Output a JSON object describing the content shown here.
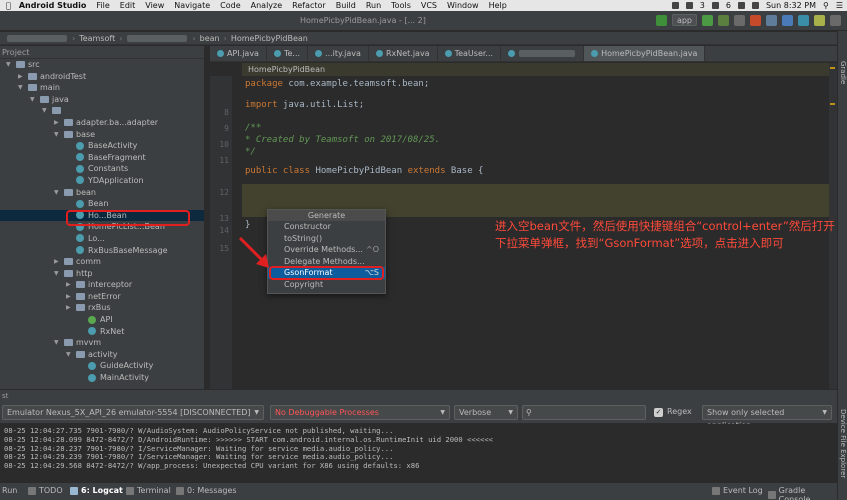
{
  "menubar": {
    "app_name": "Android Studio",
    "items": [
      "File",
      "Edit",
      "View",
      "Navigate",
      "Code",
      "Analyze",
      "Refactor",
      "Build",
      "Run",
      "Tools",
      "VCS",
      "Window",
      "Help"
    ],
    "badge_count_1": "3",
    "badge_count_2": "6",
    "clock": "Sun 8:32 PM"
  },
  "window": {
    "title": "HomePicbyPidBean.java - [... 2]"
  },
  "toolbar": {
    "run_config": "app"
  },
  "navbar": {
    "crumb_1": "Teamsoft",
    "crumb_2": "bean",
    "crumb_3": "HomePicbyPidBean"
  },
  "project": {
    "header": "Project",
    "tree": [
      {
        "label": "src",
        "type": "folder",
        "depth": 1,
        "expanded": true
      },
      {
        "label": "androidTest",
        "type": "folder",
        "depth": 2,
        "expanded": false
      },
      {
        "label": "main",
        "type": "folder",
        "depth": 2,
        "expanded": true
      },
      {
        "label": "java",
        "type": "folder",
        "depth": 3,
        "expanded": true
      },
      {
        "label": "",
        "type": "folder",
        "depth": 4,
        "expanded": true
      },
      {
        "label": "adapter.ba...adapter",
        "type": "folder",
        "depth": 5,
        "expanded": false
      },
      {
        "label": "base",
        "type": "folder",
        "depth": 5,
        "expanded": true
      },
      {
        "label": "BaseActivity",
        "type": "class",
        "depth": 6
      },
      {
        "label": "BaseFragment",
        "type": "class",
        "depth": 6
      },
      {
        "label": "Constants",
        "type": "class",
        "depth": 6
      },
      {
        "label": "YDApplication",
        "type": "class",
        "depth": 6
      },
      {
        "label": "bean",
        "type": "folder",
        "depth": 5,
        "expanded": true
      },
      {
        "label": "Bean",
        "type": "class",
        "depth": 6
      },
      {
        "label": "Ho...Bean",
        "type": "class",
        "depth": 6,
        "selected": true
      },
      {
        "label": "HomePicList...Bean",
        "type": "class",
        "depth": 6
      },
      {
        "label": "Lo...",
        "type": "class",
        "depth": 6
      },
      {
        "label": "RxBusBaseMessage",
        "type": "class",
        "depth": 6
      },
      {
        "label": "comm",
        "type": "folder",
        "depth": 5,
        "expanded": false
      },
      {
        "label": "http",
        "type": "folder",
        "depth": 5,
        "expanded": true
      },
      {
        "label": "interceptor",
        "type": "folder",
        "depth": 6,
        "expanded": false
      },
      {
        "label": "netError",
        "type": "folder",
        "depth": 6,
        "expanded": false
      },
      {
        "label": "rxBus",
        "type": "folder",
        "depth": 6,
        "expanded": false
      },
      {
        "label": "API",
        "type": "interface",
        "depth": 7
      },
      {
        "label": "RxNet",
        "type": "class",
        "depth": 7
      },
      {
        "label": "mvvm",
        "type": "folder",
        "depth": 5,
        "expanded": true
      },
      {
        "label": "activity",
        "type": "folder",
        "depth": 6,
        "expanded": true
      },
      {
        "label": "GuideActivity",
        "type": "class",
        "depth": 7
      },
      {
        "label": "MainActivity",
        "type": "class",
        "depth": 7
      }
    ]
  },
  "tabs": [
    {
      "label": "API.java",
      "active": false
    },
    {
      "label": "Te...",
      "active": false
    },
    {
      "label": "...ity.java",
      "active": false
    },
    {
      "label": "RxNet.java",
      "active": false
    },
    {
      "label": "TeaUser...",
      "active": false
    },
    {
      "label": "",
      "active": false
    },
    {
      "label": "HomePicbyPidBean.java",
      "active": true
    }
  ],
  "editor": {
    "breadcrumb": "HomePicbyPidBean",
    "line_numbers": [
      "8",
      "9",
      "10",
      "11",
      "12",
      "13",
      "14",
      "15"
    ],
    "code": {
      "l1_kw": "package",
      "l1_rest": " com.example.teamsoft.bean;",
      "l3_kw": "import",
      "l3_rest": " java.util.List;",
      "l5": "/**",
      "l6": " * Created by Teamsoft on 2017/08/25.",
      "l7": " */",
      "l9_kw1": "public class",
      "l9_name": " HomePicbyPidBean ",
      "l9_kw2": "extends",
      "l9_rest": " Base {",
      "l13": "}"
    }
  },
  "generate_popup": {
    "title": "Generate",
    "items": [
      {
        "label": "Constructor",
        "shortcut": ""
      },
      {
        "label": "toString()",
        "shortcut": ""
      },
      {
        "label": "Override Methods...",
        "shortcut": "^O"
      },
      {
        "label": "Delegate Methods...",
        "shortcut": ""
      },
      {
        "label": "GsonFormat",
        "shortcut": "⌥S",
        "selected": true
      },
      {
        "label": "Copyright",
        "shortcut": ""
      }
    ]
  },
  "annotation": {
    "text": "进入空bean文件，然后使用快捷键组合“control+enter”然后打开下拉菜单弹框，找到“GsonFormat”选项，点击进入即可",
    "color": "#ff4a3a"
  },
  "logcat": {
    "panel_label": "st",
    "device": "Emulator Nexus_5X_API_26 emulator-5554 [DISCONNECTED]",
    "process": "No Debuggable Processes",
    "level": "Verbose",
    "search_placeholder": "",
    "regex_label": "Regex",
    "filter": "Show only selected application",
    "lines": [
      "08-25 12:04:27.735 7901-7980/? W/AudioSystem: AudioPolicyService not published, waiting...",
      "08-25 12:04:28.099 8472-8472/? D/AndroidRuntime: >>>>>> START com.android.internal.os.RuntimeInit uid 2000 <<<<<<",
      "08-25 12:04:28.237 7901-7980/? I/ServiceManager: Waiting for service media.audio_policy...",
      "08-25 12:04:29.239 7901-7980/? I/ServiceManager: Waiting for service media.audio_policy...",
      "08-25 12:04:29.568 8472-8472/? W/app_process: Unexpected CPU variant for X86 using defaults: x86"
    ]
  },
  "bottom_tools": {
    "run": "Run",
    "todo": "TODO",
    "logcat": "6: Logcat",
    "terminal": "Terminal",
    "messages": "0: Messages",
    "event_log": "Event Log",
    "gradle_console": "Gradle Console"
  },
  "right_strip": {
    "gradle": "Gradle",
    "device_file_explorer": "Device File Explorer"
  },
  "colors": {
    "accent": "#0d5c9e",
    "highlight_red": "#e02020",
    "keyword": "#cc7832",
    "comment": "#629755"
  }
}
